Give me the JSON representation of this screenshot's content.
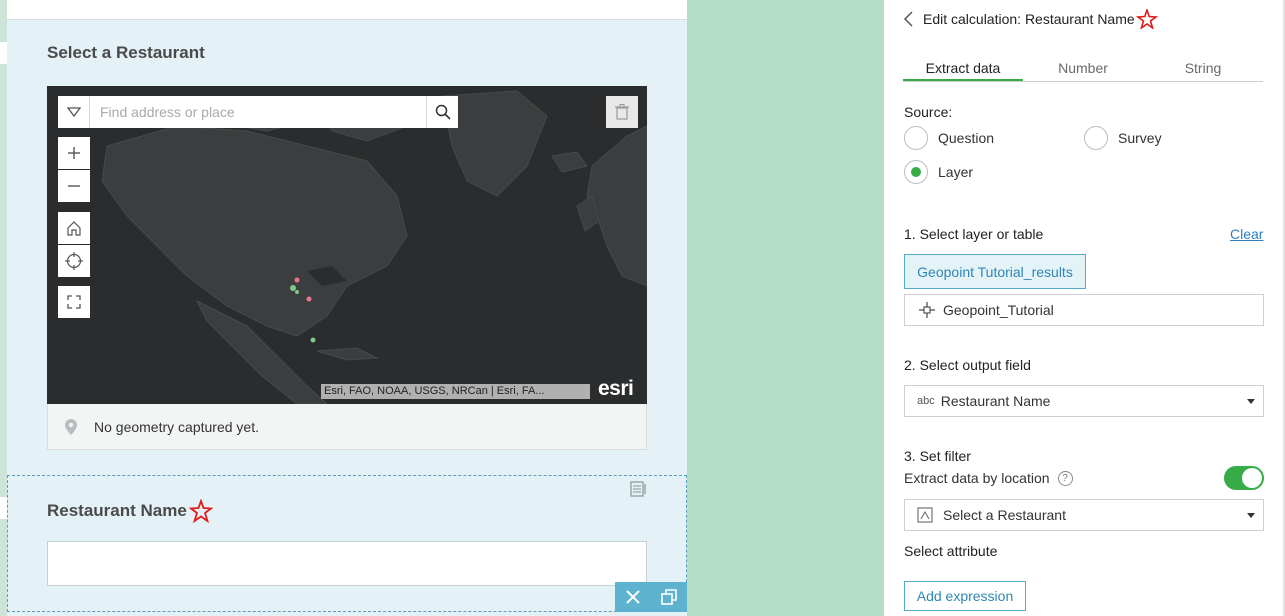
{
  "form": {
    "question1": {
      "title": "Select a Restaurant",
      "search_placeholder": "Find address or place",
      "attribution": "Esri, FAO, NOAA, USGS, NRCan | Esri, FA...",
      "logo": "esri",
      "geometry_status": "No geometry captured yet."
    },
    "question2": {
      "title": "Restaurant Name",
      "value": ""
    }
  },
  "panel": {
    "header": "Edit calculation: Restaurant Name",
    "tabs": [
      {
        "label": "Extract data",
        "active": true
      },
      {
        "label": "Number",
        "active": false
      },
      {
        "label": "String",
        "active": false
      }
    ],
    "source": {
      "label": "Source:",
      "options": [
        {
          "label": "Question",
          "checked": false
        },
        {
          "label": "Survey",
          "checked": false
        },
        {
          "label": "Layer",
          "checked": true
        }
      ]
    },
    "step1": {
      "label": "1. Select layer or table",
      "clear": "Clear",
      "layer_button": "Geopoint Tutorial_results",
      "layer_name": "Geopoint_Tutorial"
    },
    "step2": {
      "label": "2. Select output field",
      "type_tag": "abc",
      "field": "Restaurant Name"
    },
    "step3": {
      "label": "3. Set filter",
      "extract_by_location": "Extract data by location",
      "help": "?",
      "toggle_on": true,
      "filter_question": "Select a Restaurant",
      "select_attribute": "Select attribute",
      "add_expression": "Add expression"
    }
  },
  "colors": {
    "accent_green": "#35ac46",
    "accent_blue": "#2f87b3",
    "background": "#b5dcc7",
    "form_bg": "#e4f1f6",
    "map_bg": "#2b2d2e"
  },
  "icons": [
    "chevron-down-icon",
    "search-icon",
    "trash-icon",
    "plus-icon",
    "minus-icon",
    "home-icon",
    "locate-icon",
    "fullscreen-icon",
    "pin-icon",
    "required-star-icon",
    "calculation-icon",
    "close-icon",
    "duplicate-icon",
    "back-chevron-icon",
    "crosshair-icon",
    "question-icon"
  ]
}
